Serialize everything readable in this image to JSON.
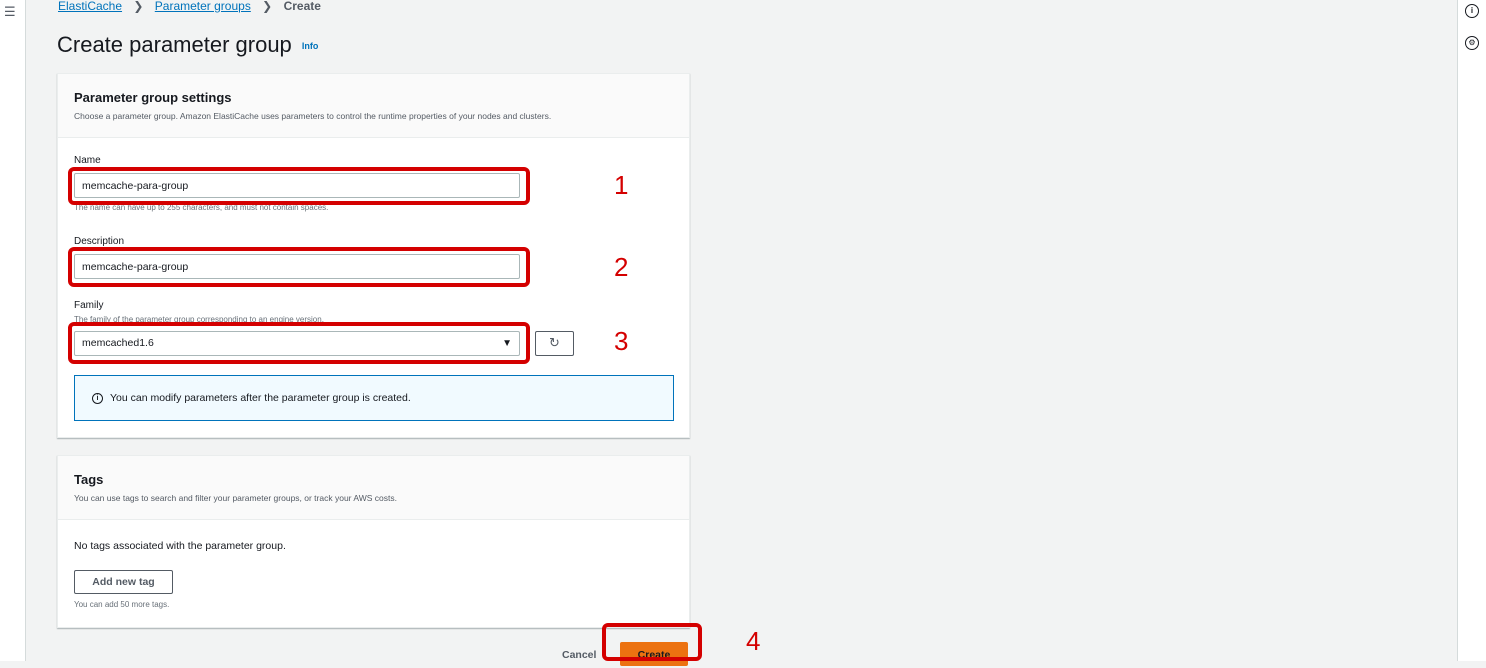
{
  "breadcrumb": {
    "items": [
      "ElastiCache",
      "Parameter groups"
    ],
    "current": "Create"
  },
  "page": {
    "title": "Create parameter group",
    "info_link": "Info"
  },
  "settings_panel": {
    "title": "Parameter group settings",
    "description": "Choose a parameter group. Amazon ElastiCache uses parameters to control the runtime properties of your nodes and clusters.",
    "name": {
      "label": "Name",
      "value": "memcache-para-group",
      "hint": "The name can have up to 255 characters, and must not contain spaces."
    },
    "description_field": {
      "label": "Description",
      "value": "memcache-para-group"
    },
    "family": {
      "label": "Family",
      "hint": "The family of the parameter group corresponding to an engine version.",
      "selected": "memcached1.6"
    },
    "alert": "You can modify parameters after the parameter group is created."
  },
  "tags_panel": {
    "title": "Tags",
    "description": "You can use tags to search and filter your parameter groups, or track your AWS costs.",
    "empty_text": "No tags associated with the parameter group.",
    "add_button": "Add new tag",
    "limit_hint": "You can add 50 more tags."
  },
  "footer": {
    "cancel": "Cancel",
    "create": "Create"
  },
  "annotations": [
    "1",
    "2",
    "3",
    "4"
  ],
  "icons": {
    "menu": "hamburger-icon",
    "info": "info-icon",
    "notifications": "settings-gear-icon",
    "refresh": "refresh-icon",
    "dropdown": "caret-down-icon"
  },
  "colors": {
    "link": "#0073bb",
    "primary_button": "#ec7211",
    "annotation": "#d40000",
    "alert_border": "#0073bb",
    "alert_bg": "#f1faff"
  }
}
